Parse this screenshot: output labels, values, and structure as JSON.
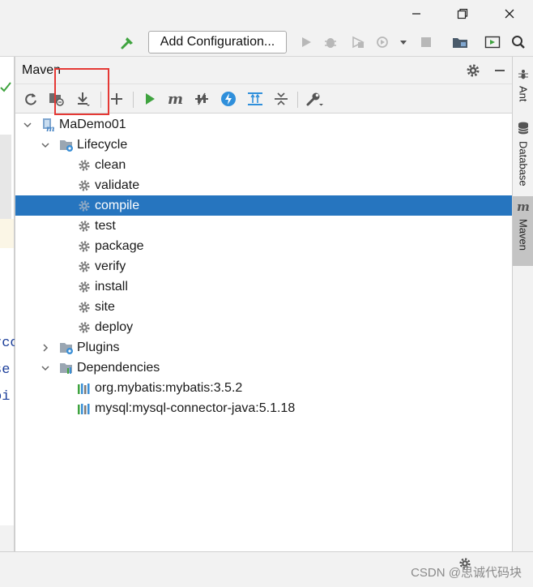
{
  "colors": {
    "accent_selected": "#2675bf",
    "run_green": "#3fa33f",
    "maven_blue": "#4a86c5",
    "highlight_red": "#e53935"
  },
  "toolbar": {
    "add_configuration": "Add Configuration..."
  },
  "maven": {
    "title": "Maven",
    "root": "MaDemo01",
    "lifecycle": {
      "label": "Lifecycle",
      "goals": [
        "clean",
        "validate",
        "compile",
        "test",
        "package",
        "verify",
        "install",
        "site",
        "deploy"
      ],
      "selected": "compile"
    },
    "plugins": "Plugins",
    "dependencies": {
      "label": "Dependencies",
      "items": [
        "org.mybatis:mybatis:3.5.2",
        "mysql:mysql-connector-java:5.1.18"
      ]
    }
  },
  "side_tabs": [
    "Ant",
    "Database",
    "Maven"
  ],
  "editor_fragments": [
    "rcc",
    "se",
    "oi"
  ],
  "watermark": "CSDN @思诚代码块"
}
